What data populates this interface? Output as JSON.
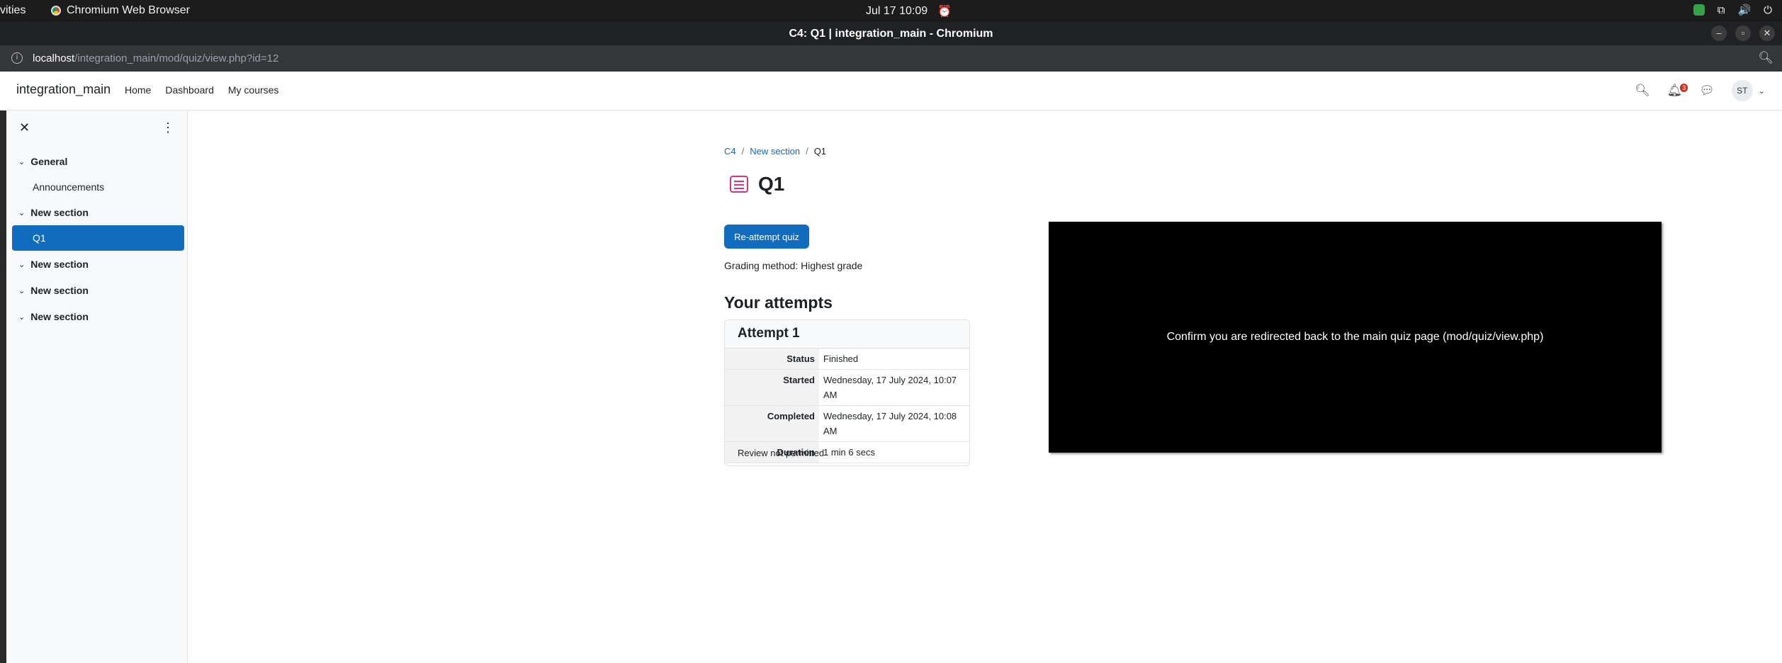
{
  "system_bar": {
    "activities": "vities",
    "app_name": "Chromium Web Browser",
    "clock": "Jul 17  10:09"
  },
  "browser": {
    "window_title": "C4: Q1 | integration_main - Chromium",
    "url_host": "localhost",
    "url_path": "/integration_main/mod/quiz/view.php?id=12"
  },
  "navbar": {
    "brand": "integration_main",
    "links": [
      "Home",
      "Dashboard",
      "My courses"
    ],
    "notification_count": "3",
    "user_initials": "ST"
  },
  "course_index": {
    "sections": [
      {
        "title": "General",
        "items": [
          "Announcements"
        ]
      },
      {
        "title": "New section",
        "items": [
          "Q1"
        ]
      },
      {
        "title": "New section",
        "items": []
      },
      {
        "title": "New section",
        "items": []
      },
      {
        "title": "New section",
        "items": []
      }
    ],
    "active_item": "Q1"
  },
  "breadcrumb": [
    "C4",
    "New section",
    "Q1"
  ],
  "page": {
    "title": "Q1",
    "reattempt_label": "Re-attempt quiz",
    "grading_method": "Grading method: Highest grade",
    "attempts_heading": "Your attempts"
  },
  "attempt": {
    "title": "Attempt 1",
    "rows": [
      {
        "label": "Status",
        "value": "Finished"
      },
      {
        "label": "Started",
        "value": "Wednesday, 17 July 2024, 10:07 AM"
      },
      {
        "label": "Completed",
        "value": "Wednesday, 17 July 2024, 10:08 AM"
      },
      {
        "label": "Duration",
        "value": "1 min 6 secs"
      }
    ],
    "review": "Review not permitted"
  },
  "overlay": {
    "message": "Confirm you are redirected back to the main quiz page (mod/quiz/view.php)"
  },
  "colors": {
    "primary": "#0f6cbf",
    "quiz_icon": "#d63384"
  }
}
